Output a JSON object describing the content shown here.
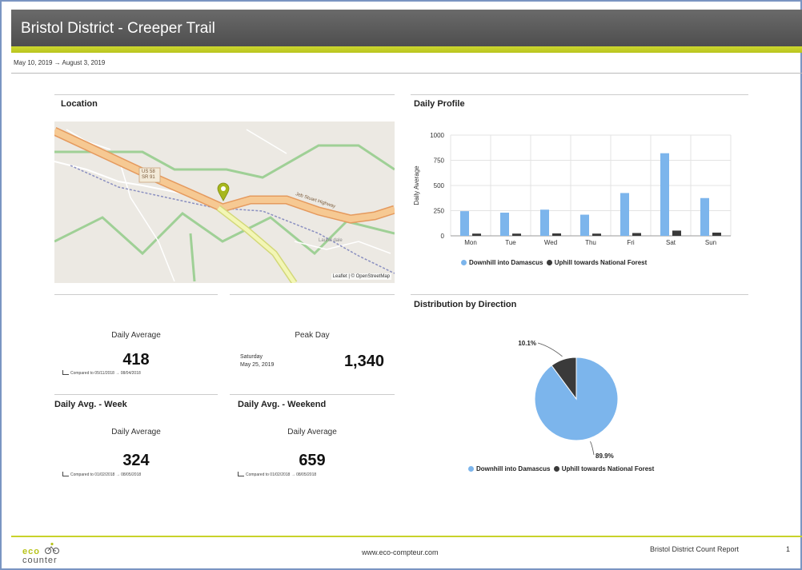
{
  "header": {
    "title": "Bristol District - Creeper Trail",
    "date_range": "May 10, 2019 → August 3, 2019",
    "colors": {
      "title_bg": "#5a5a5a",
      "accent": "#c2cd24"
    }
  },
  "location": {
    "title": "Location",
    "map_attribution": "Leaflet | © OpenStreetMap",
    "road_shield": "US 58\nSR 91",
    "road_label": "Jeb Stuart Highway",
    "place_label": "Laurel dale",
    "marker_icon": "map-pin-icon"
  },
  "daily_average_card": {
    "label": "Daily Average",
    "value": "418",
    "compare_label": "Compared to",
    "compare_range": "05/11/2018 → 08/04/2018"
  },
  "peak_day_card": {
    "label": "Peak Day",
    "day": "Saturday",
    "date": "May 25, 2019",
    "value": "1,340"
  },
  "week_card": {
    "title": "Daily Avg. - Week",
    "label": "Daily Average",
    "value": "324",
    "compare_label": "Compared to",
    "compare_range": "01/02/2018 → 08/05/2018"
  },
  "weekend_card": {
    "title": "Daily Avg. - Weekend",
    "label": "Daily Average",
    "value": "659",
    "compare_label": "Compared to",
    "compare_range": "01/02/2018 → 08/05/2018"
  },
  "daily_profile": {
    "title": "Daily Profile",
    "ylabel": "Daily Average"
  },
  "distribution": {
    "title": "Distribution by Direction"
  },
  "legend": {
    "downhill": "Downhill into Damascus",
    "uphill": "Uphill towards National Forest"
  },
  "footer": {
    "logo_top": "eco",
    "logo_bottom": "counter",
    "url": "www.eco-compteur.com",
    "report": "Bristol District Count Report",
    "page": "1"
  },
  "chart_data": [
    {
      "type": "bar",
      "title": "Daily Profile",
      "xlabel": "",
      "ylabel": "Daily Average",
      "ylim": [
        0,
        1000
      ],
      "yticks": [
        0,
        250,
        500,
        750,
        1000
      ],
      "categories": [
        "Mon",
        "Tue",
        "Wed",
        "Thu",
        "Fri",
        "Sat",
        "Sun"
      ],
      "series": [
        {
          "name": "Downhill into Damascus",
          "color": "#7cb5ec",
          "values": [
            245,
            230,
            260,
            210,
            425,
            820,
            375
          ]
        },
        {
          "name": "Uphill towards National Forest",
          "color": "#3a3a3a",
          "values": [
            22,
            22,
            24,
            22,
            28,
            52,
            32
          ]
        }
      ],
      "grid": true,
      "legend": "bottom"
    },
    {
      "type": "pie",
      "title": "Distribution by Direction",
      "slices": [
        {
          "name": "Downhill into Damascus",
          "value": 89.9,
          "label": "89.9%",
          "color": "#7cb5ec"
        },
        {
          "name": "Uphill towards National Forest",
          "value": 10.1,
          "label": "10.1%",
          "color": "#3a3a3a"
        }
      ],
      "legend": "bottom"
    }
  ]
}
